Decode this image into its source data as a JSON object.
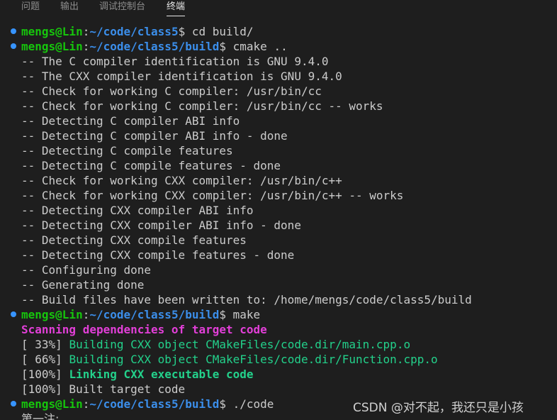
{
  "tabs": [
    "问题",
    "输出",
    "调试控制台",
    "终端"
  ],
  "prompts": [
    {
      "user": "mengs@Lin",
      "sep": ":",
      "path": "~/code/class5",
      "cmd": "$ cd build/"
    },
    {
      "user": "mengs@Lin",
      "sep": ":",
      "path": "~/code/class5/build",
      "cmd": "$ cmake .."
    },
    {
      "user": "mengs@Lin",
      "sep": ":",
      "path": "~/code/class5/build",
      "cmd": "$ make"
    },
    {
      "user": "mengs@Lin",
      "sep": ":",
      "path": "~/code/class5/build",
      "cmd": "$ ./code"
    }
  ],
  "cmake_output": [
    "-- The C compiler identification is GNU 9.4.0",
    "-- The CXX compiler identification is GNU 9.4.0",
    "-- Check for working C compiler: /usr/bin/cc",
    "-- Check for working C compiler: /usr/bin/cc -- works",
    "-- Detecting C compiler ABI info",
    "-- Detecting C compiler ABI info - done",
    "-- Detecting C compile features",
    "-- Detecting C compile features - done",
    "-- Check for working CXX compiler: /usr/bin/c++",
    "-- Check for working CXX compiler: /usr/bin/c++ -- works",
    "-- Detecting CXX compiler ABI info",
    "-- Detecting CXX compiler ABI info - done",
    "-- Detecting CXX compile features",
    "-- Detecting CXX compile features - done",
    "-- Configuring done",
    "-- Generating done",
    "-- Build files have been written to: /home/mengs/code/class5/build"
  ],
  "make_output": {
    "scanning": "Scanning dependencies of target code",
    "build1_pct": "[ 33%] ",
    "build1_msg": "Building CXX object CMakeFiles/code.dir/main.cpp.o",
    "build2_pct": "[ 66%] ",
    "build2_msg": "Building CXX object CMakeFiles/code.dir/Function.cpp.o",
    "link_pct": "[100%] ",
    "link_msg": "Linking CXX executable code",
    "built": "[100%] Built target code"
  },
  "program_output": "第一注:",
  "watermark": "CSDN @对不起，我还只是小孩",
  "colors": {
    "background": "#1e1e1e",
    "prompt_user": "#16c60c",
    "prompt_path": "#3b8eea",
    "scanning": "#e23fd8",
    "building": "#23d18b",
    "status_dot": "#3794ff"
  }
}
